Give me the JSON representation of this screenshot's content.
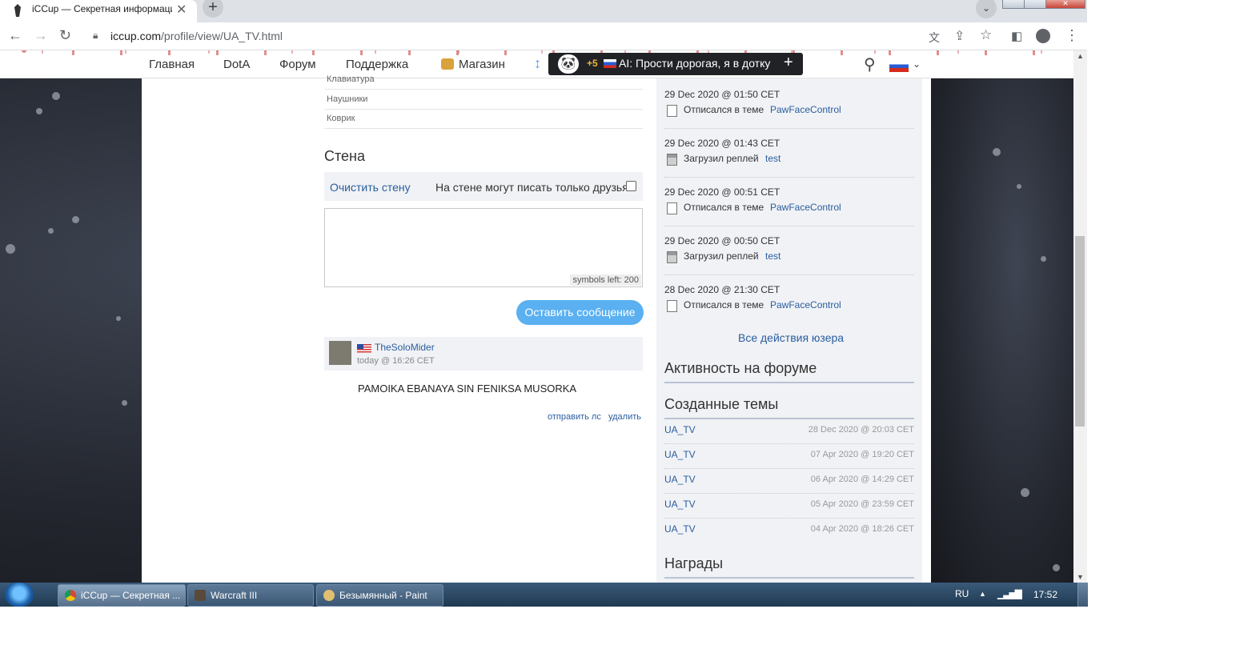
{
  "browser": {
    "tab_title": "iCCup — Секретная информаци",
    "url_domain": "iccup.com",
    "url_path": "/profile/view/UA_TV.html"
  },
  "nav": {
    "home": "Главная",
    "dota": "DotA",
    "forum": "Форум",
    "support": "Поддержка",
    "shop": "Магазин",
    "notify_count": "+5",
    "notify_text": "AI:  Прости дорогая, я в дотку"
  },
  "profile_specs": [
    "Клавиатура",
    "Наушники",
    "Коврик"
  ],
  "wall": {
    "title": "Стена",
    "clear_label": "Очистить стену",
    "friends_only_label": "На стене могут писать только друзья",
    "symbols_left": "symbols left: 200",
    "submit_label": "Оставить сообщение",
    "post": {
      "author": "TheSoloMider",
      "time": "today @ 16:26 CET",
      "body": "PAMOIKA EBANAYA SIN FENIKSA MUSORKA",
      "pm_label": "отправить лс",
      "delete_label": "удалить"
    }
  },
  "activity": [
    {
      "date": "29 Dec 2020 @ 01:50 CET",
      "text": "Отписался в теме",
      "link": "PawFaceControl",
      "icon": "post-icon"
    },
    {
      "date": "29 Dec 2020 @ 01:43 CET",
      "text": "Загрузил реплей",
      "link": "test",
      "icon": "replay-icon"
    },
    {
      "date": "29 Dec 2020 @ 00:51 CET",
      "text": "Отписался в теме",
      "link": "PawFaceControl",
      "icon": "post-icon"
    },
    {
      "date": "29 Dec 2020 @ 00:50 CET",
      "text": "Загрузил реплей",
      "link": "test",
      "icon": "replay-icon"
    },
    {
      "date": "28 Dec 2020 @ 21:30 CET",
      "text": "Отписался в теме",
      "link": "PawFaceControl",
      "icon": "post-icon"
    }
  ],
  "all_actions_label": "Все действия юзера",
  "forum_activity_title": "Активность на форуме",
  "created_topics_title": "Созданные темы",
  "topics": [
    {
      "name": "UA_TV",
      "date": "28 Dec 2020 @ 20:03 CET"
    },
    {
      "name": "UA_TV",
      "date": "07 Apr 2020 @ 19:20 CET"
    },
    {
      "name": "UA_TV",
      "date": "06 Apr 2020 @ 14:29 CET"
    },
    {
      "name": "UA_TV",
      "date": "05 Apr 2020 @ 23:59 CET"
    },
    {
      "name": "UA_TV",
      "date": "04 Apr 2020 @ 18:26 CET"
    }
  ],
  "awards_title": "Награды",
  "taskbar": {
    "tasks": [
      "iCCup — Секретная ...",
      "Warcraft III",
      "Безымянный - Paint"
    ],
    "lang": "RU",
    "clock": "17:52"
  },
  "colors": {
    "link": "#2a5d9f",
    "accent_button": "#5ab0f0"
  }
}
